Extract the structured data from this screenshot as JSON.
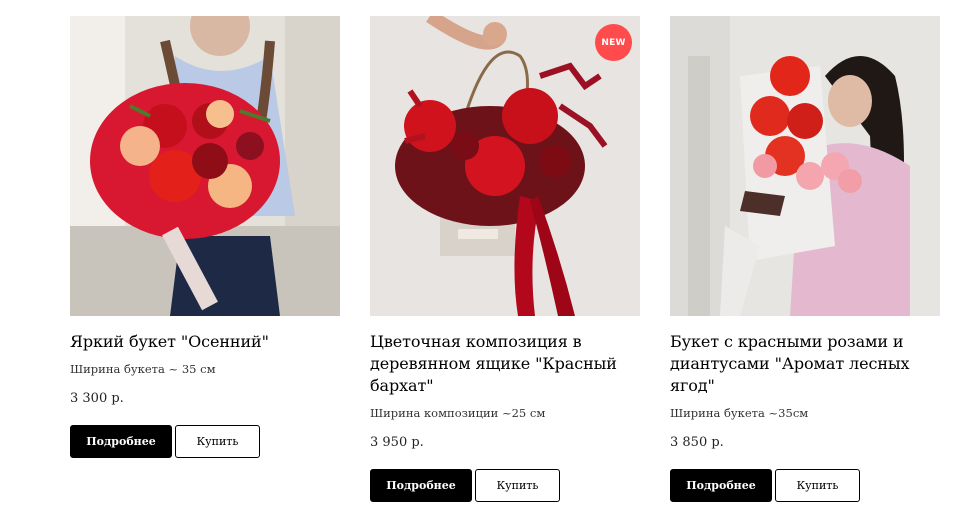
{
  "colors": {
    "badge": "#ff4b4b",
    "primary_button": "#000000",
    "secondary_button_border": "#000000"
  },
  "products": [
    {
      "title": "Яркий букет \"Осенний\"",
      "size": "Ширина букета ~ 35 см",
      "price": "3 300 р.",
      "more_label": "Подробнее",
      "buy_label": "Купить"
    },
    {
      "badge": "NEW",
      "title": "Цветочная композиция в деревянном ящике \"Красный бархат\"",
      "size": "Ширина композиции ~25 см",
      "price": "3 950 р.",
      "more_label": "Подробнее",
      "buy_label": "Купить"
    },
    {
      "title": "Букет с красными розами и диантусами \"Аромат лесных ягод\"",
      "size": "Ширина букета ~35см",
      "price": "3 850 р.",
      "more_label": "Подробнее",
      "buy_label": "Купить"
    }
  ]
}
